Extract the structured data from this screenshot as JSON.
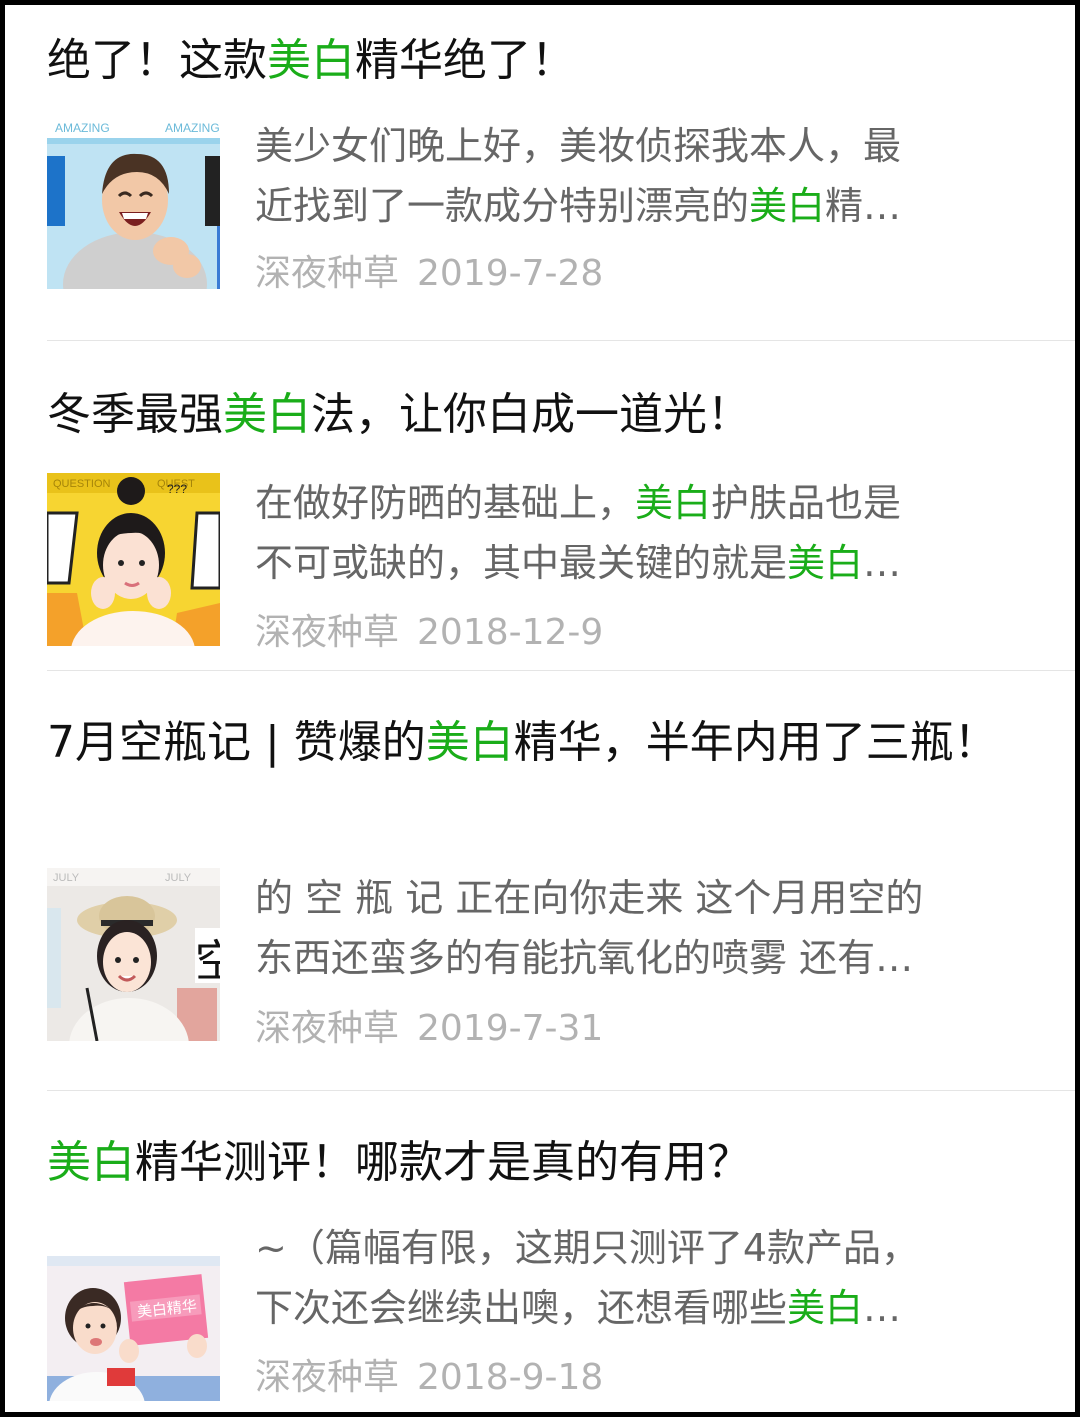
{
  "accent_color": "#1aad19",
  "articles": [
    {
      "title": [
        {
          "text": "绝了！这款",
          "hl": false
        },
        {
          "text": "美白",
          "hl": true
        },
        {
          "text": "精华绝了！",
          "hl": false
        }
      ],
      "excerpt_lines": [
        [
          {
            "text": "美少女们晚上好，美妆侦探我本人，最",
            "hl": false
          }
        ],
        [
          {
            "text": "近找到了一款成分特别漂亮的",
            "hl": false
          },
          {
            "text": "美白",
            "hl": true
          },
          {
            "text": "精…",
            "hl": false
          }
        ]
      ],
      "account": "深夜种草",
      "date": "2019-7-28",
      "thumbnail": {
        "icon": "man-laughing-thumbnail",
        "background": "#bfe3f3",
        "banner_text": "AMAZING"
      }
    },
    {
      "title": [
        {
          "text": "冬季最强",
          "hl": false
        },
        {
          "text": "美白",
          "hl": true
        },
        {
          "text": "法，让你白成一道光！",
          "hl": false
        }
      ],
      "excerpt_lines": [
        [
          {
            "text": "在做好防晒的基础上，",
            "hl": false
          },
          {
            "text": "美白",
            "hl": true
          },
          {
            "text": "护肤品也是",
            "hl": false
          }
        ],
        [
          {
            "text": "不可或缺的，其中最关键的就是",
            "hl": false
          },
          {
            "text": "美白",
            "hl": true
          },
          {
            "text": "…",
            "hl": false
          }
        ]
      ],
      "account": "深夜种草",
      "date": "2018-12-9",
      "thumbnail": {
        "icon": "girl-bun-thumbnail",
        "background": "#f7d531",
        "banner_text": "QUESTION"
      }
    },
    {
      "title": [
        {
          "text": "7月空瓶记 | 赞爆的",
          "hl": false
        },
        {
          "text": "美白",
          "hl": true
        },
        {
          "text": "精华，半年内用了三瓶！",
          "hl": false
        }
      ],
      "excerpt_lines": [
        [
          {
            "text": "的 空 瓶 记 正在向你走来 这个月用空的",
            "hl": false
          }
        ],
        [
          {
            "text": "东西还蛮多的有能抗氧化的喷雾 还有…",
            "hl": false
          }
        ]
      ],
      "account": "深夜种草",
      "date": "2019-7-31",
      "thumbnail": {
        "icon": "girl-hat-thumbnail",
        "background": "#ece9e6",
        "banner_text": "JULY"
      }
    },
    {
      "title": [
        {
          "text": "美白",
          "hl": true
        },
        {
          "text": "精华测评！哪款才是真的有用？",
          "hl": false
        }
      ],
      "excerpt_lines": [
        [
          {
            "text": "~（篇幅有限，这期只测评了4款产品，",
            "hl": false
          }
        ],
        [
          {
            "text": "下次还会继续出噢，还想看哪些",
            "hl": false
          },
          {
            "text": "美白",
            "hl": true
          },
          {
            "text": "…",
            "hl": false
          }
        ]
      ],
      "account": "深夜种草",
      "date": "2018-9-18",
      "thumbnail": {
        "icon": "boy-pink-box-thumbnail",
        "background": "#f3eef2",
        "box_text": "美白精华"
      }
    }
  ]
}
